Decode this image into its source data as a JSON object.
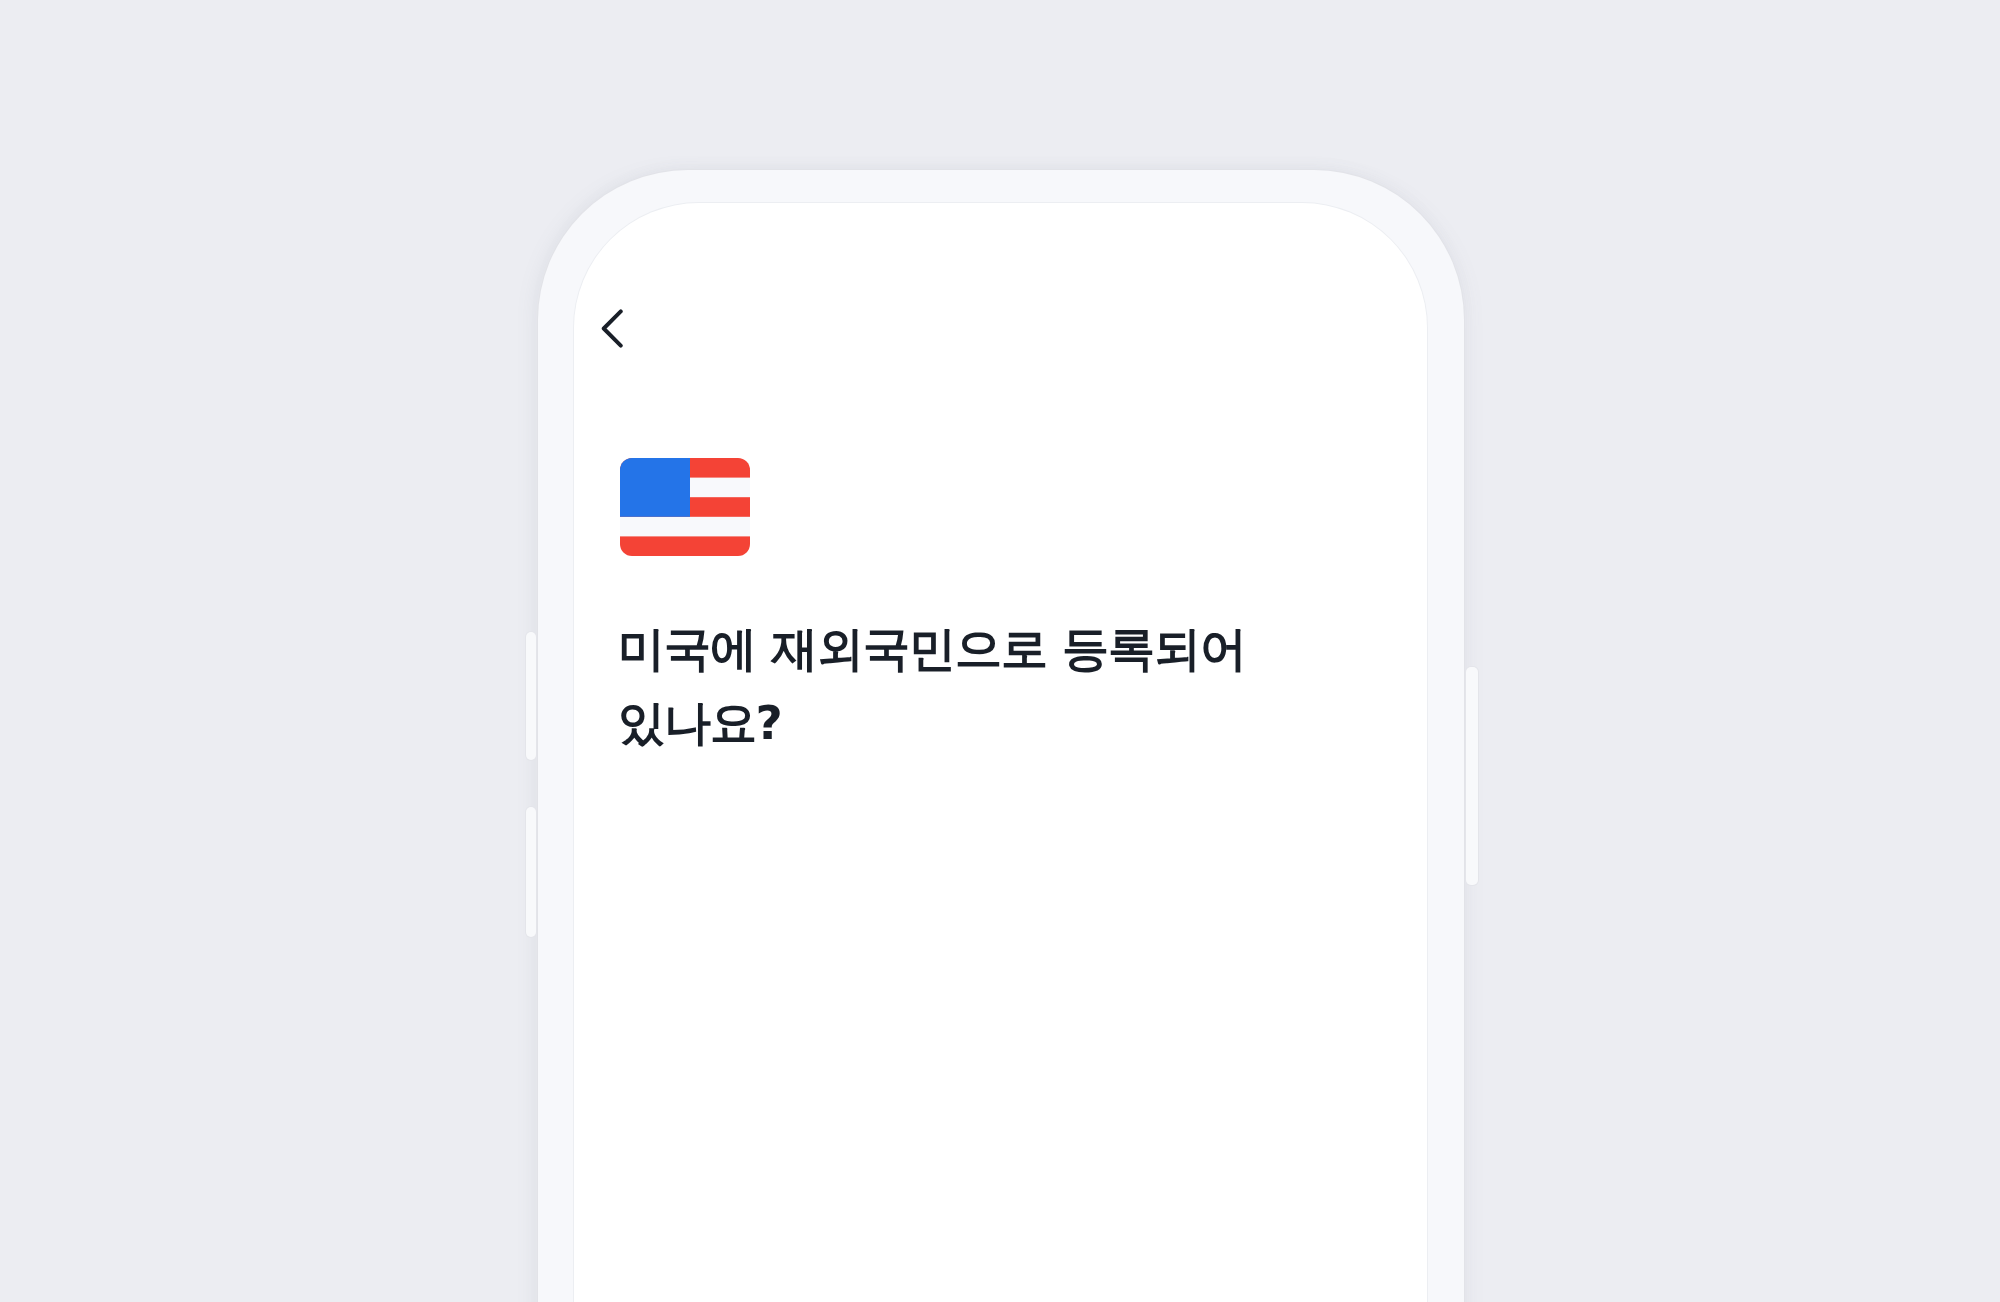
{
  "screen": {
    "title": "미국에 재외국민으로 등록되어 있나요?"
  }
}
